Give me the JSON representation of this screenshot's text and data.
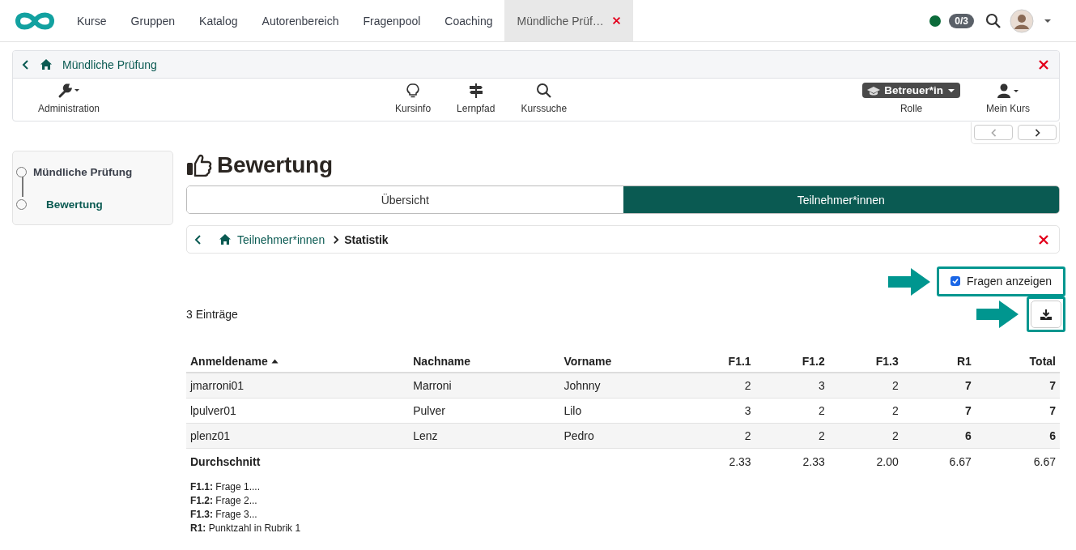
{
  "nav": {
    "tabs": [
      {
        "label": "Kurse",
        "selected": false,
        "closable": false
      },
      {
        "label": "Gruppen",
        "selected": false,
        "closable": false
      },
      {
        "label": "Katalog",
        "selected": false,
        "closable": false
      },
      {
        "label": "Autorenbereich",
        "selected": false,
        "closable": false
      },
      {
        "label": "Fragenpool",
        "selected": false,
        "closable": false
      },
      {
        "label": "Coaching",
        "selected": false,
        "closable": false
      },
      {
        "label": "Mündliche Prüf…",
        "selected": true,
        "closable": true
      }
    ],
    "status": {
      "color": "#0b6b3a"
    },
    "badge": "0/3"
  },
  "course": {
    "title": "Mündliche Prüfung",
    "tools": [
      {
        "kind": "admin",
        "label": "Administration"
      },
      {
        "kind": "info",
        "label": "Kursinfo"
      },
      {
        "kind": "path",
        "label": "Lernpfad"
      },
      {
        "kind": "search",
        "label": "Kurssuche"
      },
      {
        "kind": "role",
        "value": "Betreuer*in",
        "label": "Rolle"
      },
      {
        "kind": "user",
        "label": "Mein Kurs"
      }
    ]
  },
  "sidebar": {
    "items": [
      {
        "label": "Mündliche Prüfung",
        "selected": false,
        "children": [
          {
            "label": "Bewertung",
            "selected": true
          }
        ]
      }
    ]
  },
  "page": {
    "title": "Bewertung"
  },
  "segments": [
    {
      "label": "Übersicht",
      "selected": false
    },
    {
      "label": "Teilnehmer*innen",
      "selected": true
    }
  ],
  "breadcrumb": {
    "link": "Teilnehmer*innen",
    "current": "Statistik"
  },
  "show_questions": {
    "label": "Fragen anzeigen",
    "checked": true
  },
  "count": "3 Einträge",
  "table": {
    "columns": [
      {
        "label": "Anmeldename",
        "kind": "text",
        "sorted": true,
        "bold_values": false
      },
      {
        "label": "Nachname",
        "kind": "text",
        "sorted": false,
        "bold_values": false
      },
      {
        "label": "Vorname",
        "kind": "text",
        "sorted": false,
        "bold_values": false
      },
      {
        "label": "F1.1",
        "kind": "number",
        "sorted": false,
        "bold_values": false
      },
      {
        "label": "F1.2",
        "kind": "number",
        "sorted": false,
        "bold_values": false
      },
      {
        "label": "F1.3",
        "kind": "number",
        "sorted": false,
        "bold_values": false
      },
      {
        "label": "R1",
        "kind": "number",
        "sorted": false,
        "bold_values": true
      },
      {
        "label": "Total",
        "kind": "number",
        "sorted": false,
        "bold_values": true
      }
    ],
    "rows": [
      [
        "jmarroni01",
        "Marroni",
        "Johnny",
        "2",
        "3",
        "2",
        "7",
        "7"
      ],
      [
        "lpulver01",
        "Pulver",
        "Lilo",
        "3",
        "2",
        "2",
        "7",
        "7"
      ],
      [
        "plenz01",
        "Lenz",
        "Pedro",
        "2",
        "2",
        "2",
        "6",
        "6"
      ]
    ],
    "footer": {
      "label": "Durchschnitt",
      "values": [
        "2.33",
        "2.33",
        "2.00",
        "6.67",
        "6.67"
      ]
    }
  },
  "legend": [
    "**F1.1:** Frage 1....",
    "**F1.2:** Frage 2...",
    "**F1.3:** Frage 3...",
    "**R1:** Punktzahl in Rubrik 1"
  ]
}
